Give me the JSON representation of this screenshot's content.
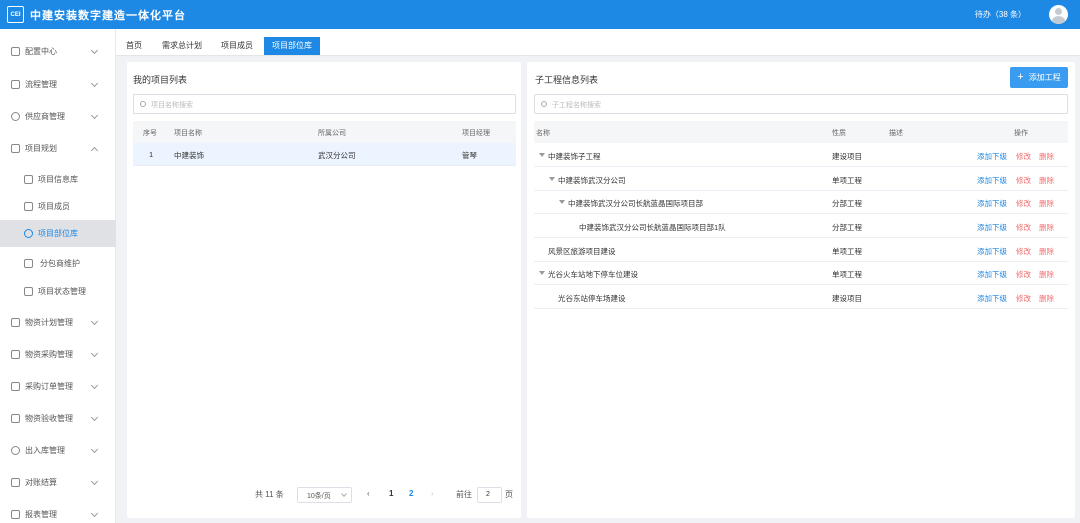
{
  "app": {
    "title": "中建安装数字建造一体化平台",
    "logo_text": "CEI",
    "todo": "待办（38 条）"
  },
  "sidebar": {
    "items": [
      {
        "label": "配置中心"
      },
      {
        "label": "流程管理"
      },
      {
        "label": "供应商管理"
      },
      {
        "label": "项目规划"
      },
      {
        "label": "项目信息库"
      },
      {
        "label": "项目成员"
      },
      {
        "label": "项目部位库"
      },
      {
        "label": "分包商维护"
      },
      {
        "label": "项目状态管理"
      },
      {
        "label": "物资计划管理"
      },
      {
        "label": "物资采购管理"
      },
      {
        "label": "采购订单管理"
      },
      {
        "label": "物资验收管理"
      },
      {
        "label": "出入库管理"
      },
      {
        "label": "对账结算"
      },
      {
        "label": "报表管理"
      }
    ]
  },
  "tabs": [
    {
      "label": "首页"
    },
    {
      "label": "需求总计划"
    },
    {
      "label": "项目成员"
    },
    {
      "label": "项目部位库"
    }
  ],
  "left_panel": {
    "title": "我的项目列表",
    "search_placeholder": "项目名称搜索",
    "columns": [
      "序号",
      "项目名称",
      "所属公司",
      "项目经理"
    ],
    "rows": [
      {
        "index": "1",
        "name": "中建装饰",
        "company": "武汉分公司",
        "manager": "管琴"
      }
    ],
    "pagination": {
      "total": "共 11 条",
      "page_size": "10条/页",
      "pages": [
        "1",
        "2"
      ],
      "goto_label": "前往",
      "goto_value": "2",
      "page_suffix": "页"
    }
  },
  "right_panel": {
    "title": "子工程信息列表",
    "search_placeholder": "子工程名称搜索",
    "add_button": "添加工程",
    "columns": [
      "名称",
      "性质",
      "描述",
      "操作"
    ],
    "op_labels": {
      "add": "添加下级",
      "edit": "修改",
      "delete": "删除"
    },
    "rows": [
      {
        "name": "中建装饰子工程",
        "type": "建设项目",
        "desc": ""
      },
      {
        "name": "中建装饰武汉分公司",
        "type": "单项工程",
        "desc": ""
      },
      {
        "name": "中建装饰武汉分公司长航蓝晶国际项目部",
        "type": "分部工程",
        "desc": ""
      },
      {
        "name": "中建装饰武汉分公司长航蓝晶国际项目部1队",
        "type": "分部工程",
        "desc": ""
      },
      {
        "name": "风景区旅游项目建设",
        "type": "单项工程",
        "desc": ""
      },
      {
        "name": "光谷火车站地下停车位建设",
        "type": "单项工程",
        "desc": ""
      },
      {
        "name": "光谷东站停车场建设",
        "type": "建设项目",
        "desc": ""
      }
    ]
  }
}
